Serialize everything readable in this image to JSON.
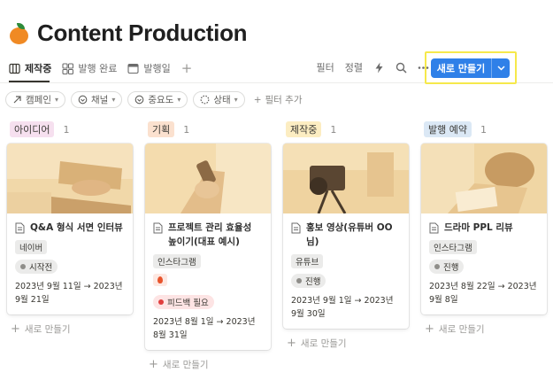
{
  "page": {
    "title": "Content Production",
    "icon": "orange-icon"
  },
  "tabs": [
    {
      "label": "제작중",
      "icon": "board-icon",
      "active": true
    },
    {
      "label": "발행 완료",
      "icon": "gallery-icon"
    },
    {
      "label": "발행일",
      "icon": "calendar-icon"
    }
  ],
  "toolbar": {
    "filter": "필터",
    "sort": "정렬",
    "new_button": "새로 만들기"
  },
  "filters": [
    {
      "label": "캠페인",
      "icon": "arrow-icon"
    },
    {
      "label": "채널",
      "icon": "circle-icon"
    },
    {
      "label": "중요도",
      "icon": "circle-icon"
    },
    {
      "label": "상태",
      "icon": "status-icon"
    }
  ],
  "add_filter": "필터 추가",
  "columns": [
    {
      "name": "아이디어",
      "count": "1",
      "color": "#f6e0ef",
      "card": {
        "title": "Q&A 형식 서면 인터뷰",
        "channel": "네이버",
        "status": "시작전",
        "status_bg": "#ebebea",
        "status_dot": "#8f8e8a",
        "dates": "2023년 9월 11일 → 2023년 9월 21일"
      }
    },
    {
      "name": "기획",
      "count": "1",
      "color": "#fbe1cf",
      "card": {
        "title": "프로젝트 관리 효율성 높이기(대표 예시)",
        "channel": "인스타그램",
        "priority": "fire-icon",
        "status": "피드백 필요",
        "status_bg": "#fde4e4",
        "status_dot": "#e03e3e",
        "dates": "2023년 8월 1일 → 2023년 8월 31일"
      }
    },
    {
      "name": "제작중",
      "count": "1",
      "color": "#fcedc2",
      "card": {
        "title": "홍보 영상(유튜버 OO님)",
        "channel": "유튜브",
        "status": "진행",
        "status_bg": "#ebebea",
        "status_dot": "#8f8e8a",
        "dates": "2023년 9월 1일 → 2023년 9월 30일"
      }
    },
    {
      "name": "발행 예약",
      "count": "1",
      "color": "#dbe8f5",
      "card": {
        "title": "드라마 PPL 리뷰",
        "channel": "인스타그램",
        "status": "진행",
        "status_bg": "#ebebea",
        "status_dot": "#8f8e8a",
        "dates": "2023년 8월 22일 → 2023년 9월 8일"
      }
    }
  ],
  "new_card_label": "새로 만들기"
}
